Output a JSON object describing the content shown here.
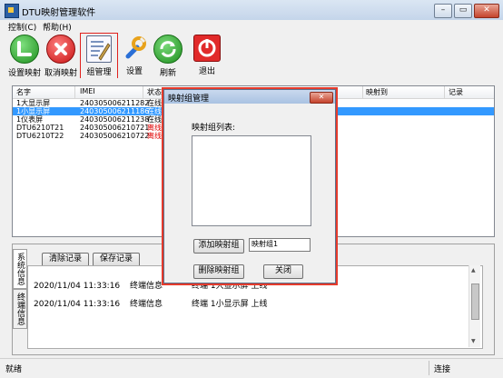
{
  "window": {
    "title": "DTU映射管理软件",
    "controls": {
      "minimize": "–",
      "maximize": "▭",
      "close": "✕"
    }
  },
  "menu": {
    "items": [
      "控制(C)",
      "帮助(H)"
    ]
  },
  "toolbar": {
    "items": [
      {
        "label": "设置映射",
        "icon": "check-icon"
      },
      {
        "label": "取消映射",
        "icon": "cancel-icon"
      },
      {
        "label": "组管理",
        "icon": "group-manage-icon",
        "selected": true
      },
      {
        "label": "设置",
        "icon": "settings-icon"
      },
      {
        "label": "刷新",
        "icon": "refresh-icon"
      },
      {
        "label": "退出",
        "icon": "exit-icon"
      }
    ]
  },
  "device_table": {
    "columns": [
      "名字",
      "IMEI",
      "状态",
      "映射到",
      "记录"
    ],
    "rows": [
      {
        "name": "1大显示屏",
        "imei": "240305006211282",
        "status": "在线",
        "status_type": "online",
        "selected": false
      },
      {
        "name": "1小显示屏",
        "imei": "240305006211186",
        "status": "在线",
        "status_type": "online",
        "selected": true
      },
      {
        "name": "1仪表屏",
        "imei": "240305006211238",
        "status": "在线",
        "status_type": "online",
        "selected": false
      },
      {
        "name": "DTU6210T21",
        "imei": "240305006210721",
        "status": "离线",
        "status_type": "offline",
        "selected": false
      },
      {
        "name": "DTU6210T22",
        "imei": "240305006210722",
        "status": "离线",
        "status_type": "offline",
        "selected": false
      }
    ]
  },
  "log_panel": {
    "tabs": [
      "系统信息",
      "终端信息"
    ],
    "buttons": {
      "clear": "清除记录",
      "save": "保存记录"
    },
    "entries": [
      {
        "time": "2020/11/04 11:33:16",
        "type": "终端信息",
        "message": "终端 1大显示屏 上线"
      },
      {
        "time": "2020/11/04 11:33:16",
        "type": "终端信息",
        "message": "终端 1小显示屏 上线"
      }
    ]
  },
  "status_bar": {
    "left": "就绪",
    "right": "连接"
  },
  "dialog": {
    "title": "映射组管理",
    "list_label": "映射组列表:",
    "add_button": "添加映射组",
    "group_name_value": "映射组1",
    "delete_button": "删除映射组",
    "close_button": "关闭"
  },
  "colors": {
    "highlight": "#e53b2c",
    "selection": "#3399ff",
    "offline": "#e00000"
  }
}
